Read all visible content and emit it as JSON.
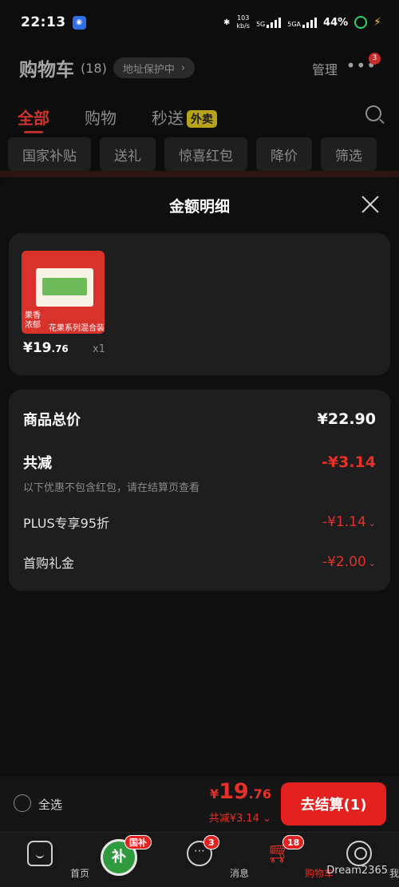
{
  "status_bar": {
    "time": "22:13",
    "net_speed_value": "103",
    "net_speed_unit": "kb/s",
    "signal1": "5G",
    "signal2": "5GA",
    "battery": "44%"
  },
  "header": {
    "title": "购物车",
    "count": "(18)",
    "address_protect": "地址保护中",
    "manage": "管理",
    "more_badge": "3"
  },
  "tabs": [
    {
      "label": "全部"
    },
    {
      "label": "购物"
    },
    {
      "label": "秒送",
      "badge": "外卖"
    }
  ],
  "filters": [
    "国家补贴",
    "送礼",
    "惊喜红包",
    "降价",
    "筛选"
  ],
  "sheet": {
    "title": "金额明细",
    "product": {
      "price_symbol": "¥",
      "price_int": "19",
      "price_dec": ".76",
      "quantity": "x1",
      "image_text_1": "果香浓郁",
      "image_text_2": "花果系列混合装"
    },
    "detail": {
      "total_label": "商品总价",
      "total_value": "¥22.90",
      "reduce_label": "共减",
      "reduce_value": "-¥3.14",
      "note": "以下优惠不包含红包，请在结算页查看",
      "plus_label": "PLUS专享95折",
      "plus_value": "-¥1.14",
      "gift_label": "首购礼金",
      "gift_value": "-¥2.00"
    }
  },
  "checkout": {
    "select_all": "全选",
    "total_symbol": "¥",
    "total_int": "19",
    "total_dec": ".76",
    "reduce_text": "共减¥3.14",
    "button": "去结算(1)"
  },
  "bottom_nav": [
    {
      "label": "首页",
      "icon": "home-icon"
    },
    {
      "label": "",
      "icon": "subsidy-icon",
      "icon_text": "补",
      "badge": "国补"
    },
    {
      "label": "消息",
      "icon": "message-icon",
      "badge": "3"
    },
    {
      "label": "购物车",
      "icon": "cart-icon",
      "badge": "18"
    },
    {
      "label": "我的",
      "icon": "profile-icon"
    }
  ],
  "watermark": "Dream2365",
  "colors": {
    "accent_red": "#e5312a",
    "background": "#0d0d0d",
    "card": "#1e1e1e"
  }
}
